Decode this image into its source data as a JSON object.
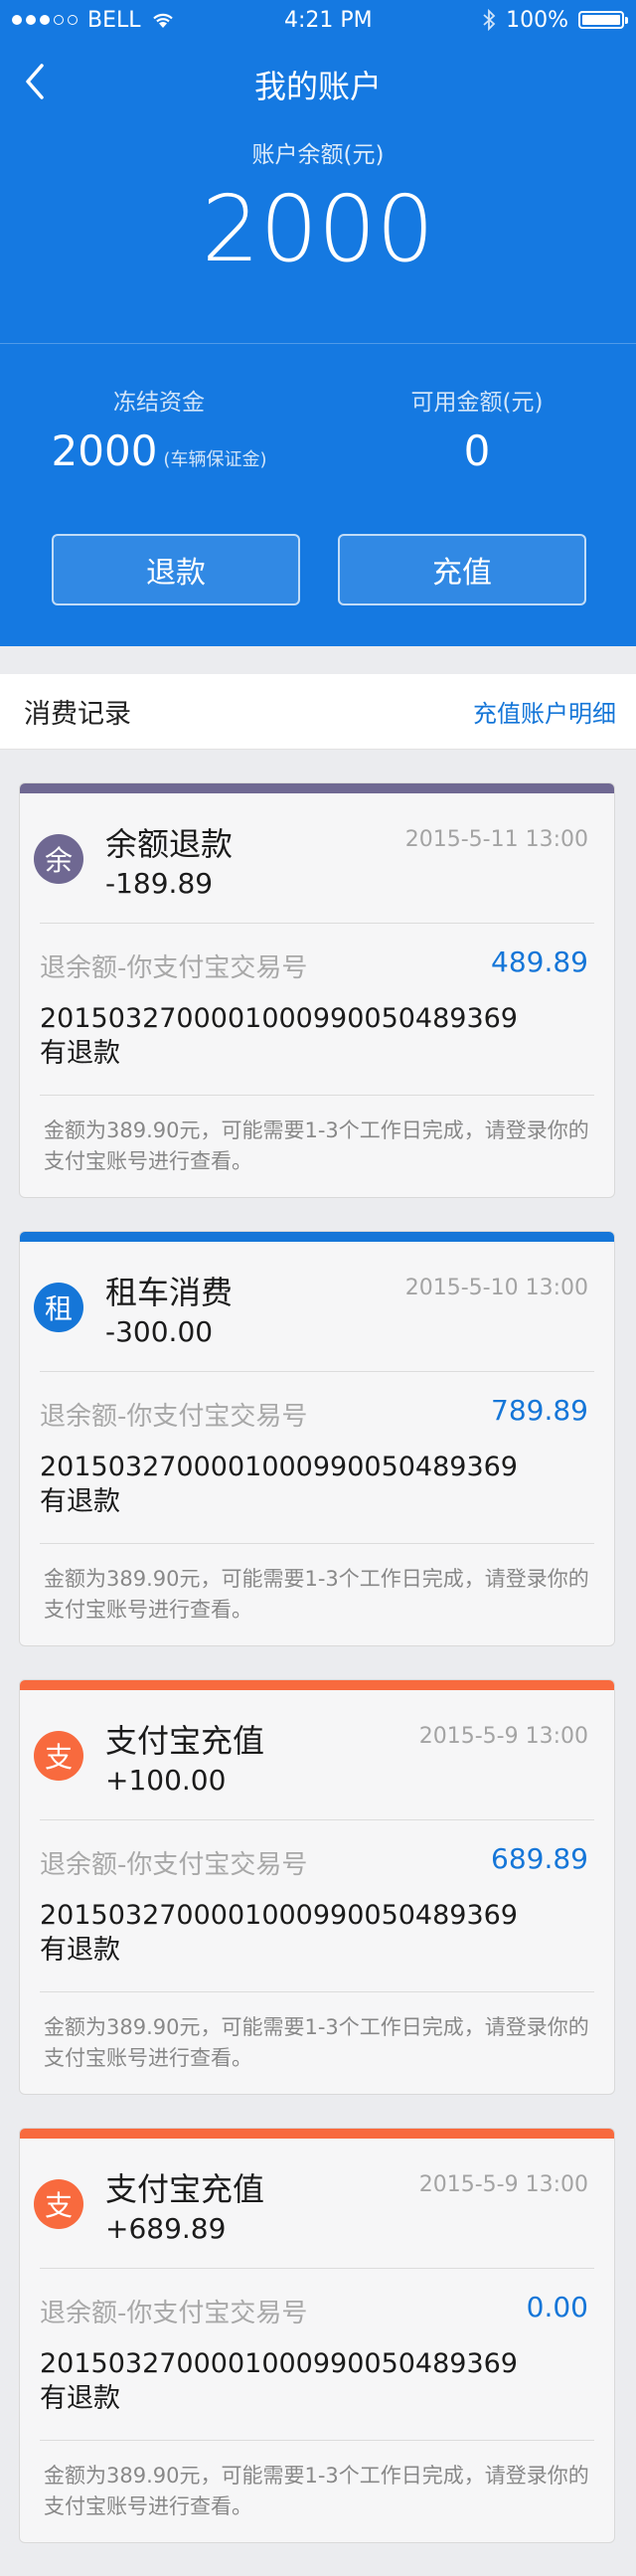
{
  "status_bar": {
    "carrier": "BELL",
    "time": "4:21 PM",
    "battery": "100%",
    "battery_level": 1.0
  },
  "nav": {
    "title": "我的账户"
  },
  "balance": {
    "label": "账户余额(元)",
    "value": "2000"
  },
  "frozen": {
    "label": "冻结资金",
    "value": "2000",
    "note": "(车辆保证金)"
  },
  "available": {
    "label": "可用金额(元)",
    "value": "0"
  },
  "buttons": {
    "refund": "退款",
    "topup": "充值"
  },
  "records": {
    "title": "消费记录",
    "link": "充值账户明细"
  },
  "cards": [
    {
      "color": "#6f6892",
      "icon_char": "余",
      "title": "余额退款",
      "amount": "-189.89",
      "date": "2015-5-11 13:00",
      "refund_label": "退余额-你支付宝交易号",
      "refund_value": "489.89",
      "txn": "2015032700001000990050489369",
      "txn_status": "有退款",
      "note": "金额为389.90元，可能需要1-3个工作日完成，请登录你的支付宝账号进行查看。"
    },
    {
      "color": "#1576d8",
      "icon_char": "租",
      "title": "租车消费",
      "amount": "-300.00",
      "date": "2015-5-10 13:00",
      "refund_label": "退余额-你支付宝交易号",
      "refund_value": "789.89",
      "txn": "2015032700001000990050489369",
      "txn_status": "有退款",
      "note": "金额为389.90元，可能需要1-3个工作日完成，请登录你的支付宝账号进行查看。"
    },
    {
      "color": "#f86a3e",
      "icon_char": "支",
      "title": "支付宝充值",
      "amount": "+100.00",
      "date": "2015-5-9 13:00",
      "refund_label": "退余额-你支付宝交易号",
      "refund_value": "689.89",
      "txn": "2015032700001000990050489369",
      "txn_status": "有退款",
      "note": "金额为389.90元，可能需要1-3个工作日完成，请登录你的支付宝账号进行查看。"
    },
    {
      "color": "#f86a3e",
      "icon_char": "支",
      "title": "支付宝充值",
      "amount": "+689.89",
      "date": "2015-5-9 13:00",
      "refund_label": "退余额-你支付宝交易号",
      "refund_value": "0.00",
      "txn": "2015032700001000990050489369",
      "txn_status": "有退款",
      "note": "金额为389.90元，可能需要1-3个工作日完成，请登录你的支付宝账号进行查看。"
    }
  ]
}
